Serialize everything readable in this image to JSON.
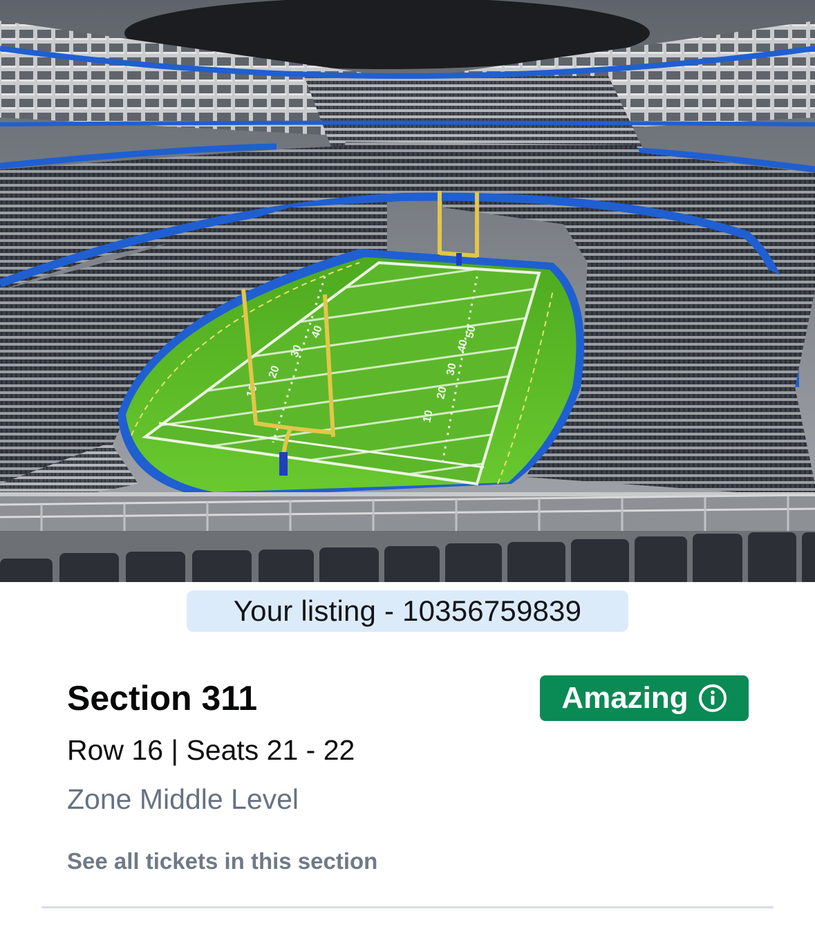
{
  "listing": {
    "label": "Your listing - 10356759839"
  },
  "ticket": {
    "section": "Section 311",
    "row_seats": "Row 16 | Seats 21 - 22",
    "zone": "Zone Middle Level",
    "see_all": "See all tickets in this section"
  },
  "rating": {
    "label": "Amazing",
    "icon": "info-icon",
    "color": "#0a8a55"
  },
  "view_image": {
    "subject": "stadium-seat-view",
    "field_numbers": [
      "10",
      "20",
      "30",
      "40",
      "50",
      "40",
      "30",
      "20",
      "10"
    ]
  },
  "colors": {
    "listing_pill_bg": "#dcebfa",
    "secondary_text": "#667283",
    "link_text": "#6f7a88",
    "stadium_blue": "#1f5fd1",
    "turf_green": "#5fbe2d"
  }
}
